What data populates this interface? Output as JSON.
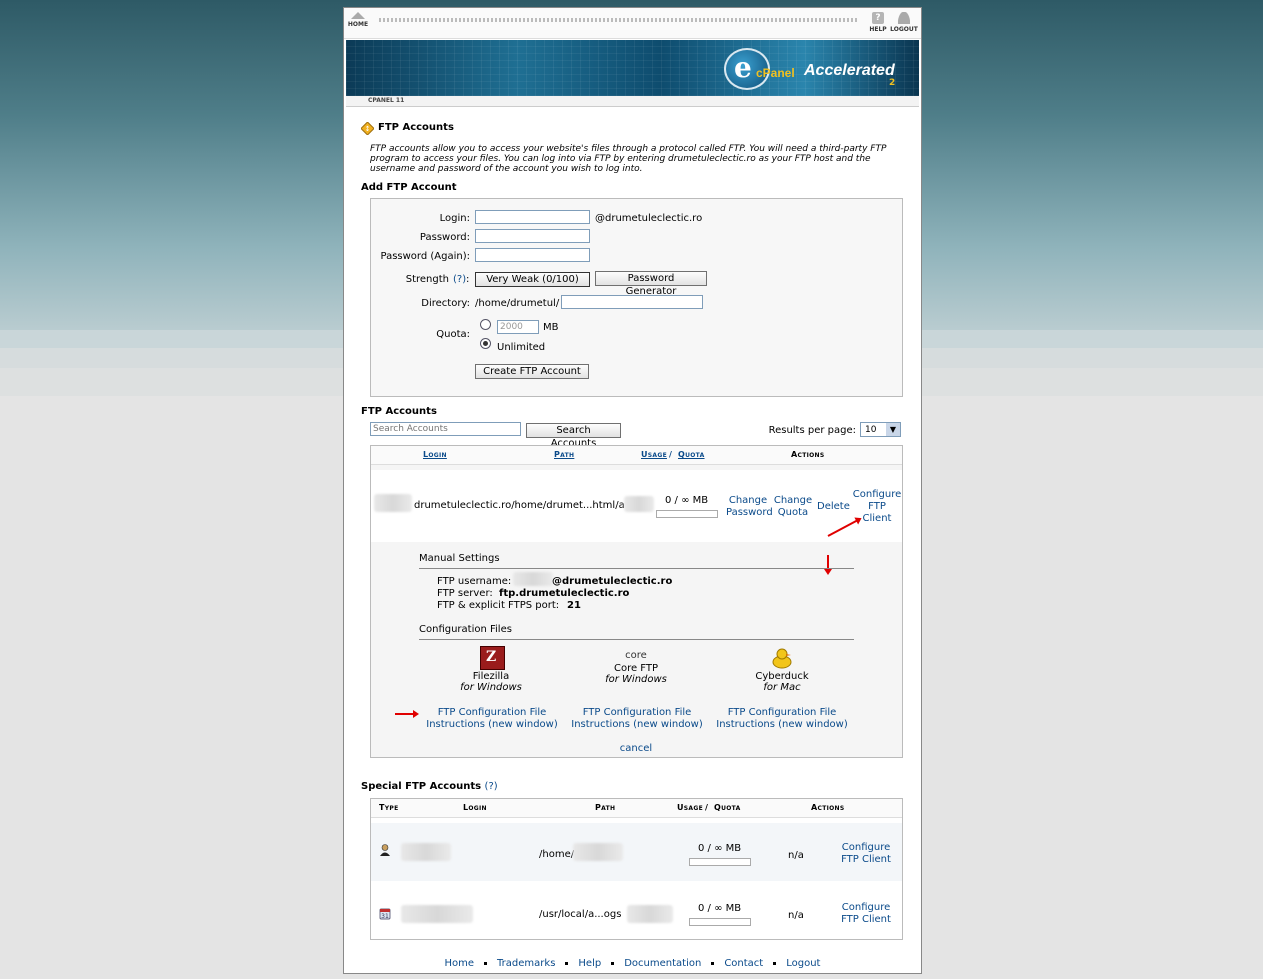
{
  "nav": {
    "home": "HOME",
    "help": "HELP",
    "logout": "LOGOUT",
    "version": "CPANEL 11"
  },
  "brand": {
    "logo_letter": "e",
    "name": "cPanel",
    "accelerated": "Accelerated",
    "two": "2"
  },
  "page": {
    "title": "FTP Accounts",
    "description": "FTP accounts allow you to access your website's files through a protocol called FTP. You will need a third-party FTP program to access your files. You can log into via FTP by entering drumetuleclectic.ro as your FTP host and the username and password of the account you wish to log into."
  },
  "add": {
    "title": "Add FTP Account",
    "login_label": "Login:",
    "domain_suffix": "@drumetuleclectic.ro",
    "password_label": "Password:",
    "password_again_label": "Password (Again):",
    "strength_label": "Strength",
    "strength_help": "(?)",
    "strength_colon": ":",
    "strength_value": "Very Weak (0/100)",
    "generator_button": "Password Generator",
    "directory_label": "Directory:",
    "directory_prefix": "/home/drumetul/",
    "quota_label": "Quota:",
    "quota_value": "2000",
    "quota_unit": "MB",
    "unlimited_label": "Unlimited",
    "create_button": "Create FTP Account"
  },
  "accounts": {
    "title": "FTP Accounts",
    "search_placeholder": "Search Accounts",
    "search_button": "Search Accounts",
    "results_label": "Results per page:",
    "results_value": "10",
    "col_login": "Login",
    "col_path": "Path",
    "col_usage": "Usage",
    "col_slash": "/",
    "col_quota": "Quota",
    "col_actions": "Actions",
    "row": {
      "login_path": "drumetuleclectic.ro/home/drumet...html/a",
      "usage": "0 / ∞ MB",
      "change_password_1": "Change",
      "change_password_2": "Password",
      "change_quota_1": "Change",
      "change_quota_2": "Quota",
      "delete": "Delete",
      "configure_1": "Configure",
      "configure_2": "FTP",
      "configure_3": "Client"
    },
    "manual": {
      "title": "Manual Settings",
      "username_label": "FTP username:",
      "username_value": "@drumetuleclectic.ro",
      "server_label": "FTP server:",
      "server_value": "ftp.drumetuleclectic.ro",
      "port_label": "FTP & explicit FTPS port:",
      "port_value": "21"
    },
    "config": {
      "title": "Configuration Files",
      "clients": [
        {
          "name": "Filezilla",
          "platform": "for Windows"
        },
        {
          "name": "Core FTP",
          "platform": "for Windows",
          "logo_text": "core"
        },
        {
          "name": "Cyberduck",
          "platform": "for Mac"
        }
      ],
      "link_1": "FTP Configuration File",
      "link_2": "Instructions (new window)",
      "cancel": "cancel"
    }
  },
  "special": {
    "title": "Special FTP Accounts",
    "help": "(?)",
    "col_type": "Type",
    "col_login": "Login",
    "col_path": "Path",
    "col_usage": "Usage",
    "col_slash": "/",
    "col_quota": "Quota",
    "col_actions": "Actions",
    "rows": [
      {
        "path": "/home/",
        "usage": "0 / ∞ MB",
        "actions": "n/a",
        "configure_1": "Configure",
        "configure_2": "FTP Client"
      },
      {
        "path": "/usr/local/a...ogs",
        "usage": "0 / ∞ MB",
        "actions": "n/a",
        "configure_1": "Configure",
        "configure_2": "FTP Client"
      }
    ]
  },
  "footer": {
    "links": [
      "Home",
      "Trademarks",
      "Help",
      "Documentation",
      "Contact",
      "Logout"
    ]
  },
  "colors": {
    "link": "#0a4a8a",
    "highlight_arrow": "#e00000",
    "panel": "#f7f7f7"
  }
}
